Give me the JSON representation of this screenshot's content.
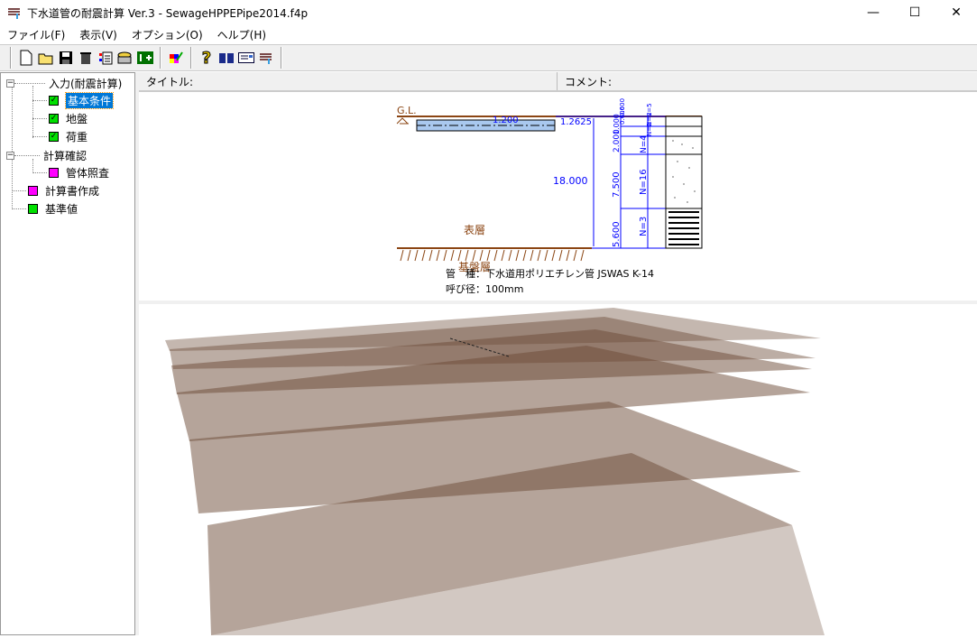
{
  "window": {
    "title": "下水道管の耐震計算 Ver.3 - SewageHPPEPipe2014.f4p",
    "minimize": "—",
    "maximize": "☐",
    "close": "✕"
  },
  "menu": [
    "ファイル(F)",
    "表示(V)",
    "オプション(O)",
    "ヘルプ(H)"
  ],
  "toolbar": {
    "icons": [
      "new-file-icon",
      "open-folder-icon",
      "save-icon",
      "trash-icon",
      "calc-icon",
      "db-icon",
      "exit-icon",
      "color-palette-icon",
      "help-icon",
      "book-icon",
      "id-card-icon",
      "app-icon"
    ]
  },
  "tree": {
    "root1": "入力(耐震計算)",
    "basic": "基本条件",
    "ground": "地盤",
    "load": "荷重",
    "root2": "計算確認",
    "pipe_check": "管体照査",
    "report": "計算書作成",
    "standard": "基準値"
  },
  "header": {
    "title_label": "タイトル:",
    "comment_label": "コメント:"
  },
  "diagram": {
    "gl": "G.L.",
    "cover": "1.200",
    "pipe_depth": "1.2625",
    "total": "18.000",
    "layer_thickness": [
      "0.600",
      "0.600",
      "1.000",
      "2.000",
      "7.500",
      "5.600"
    ],
    "n_values": [
      "N=5",
      "N=2",
      "N=2",
      "N=4",
      "N=16",
      "N=3"
    ],
    "surface_layer": "表層",
    "base_layer": "基盤層",
    "pipe_type": "管　種：下水道用ポリエチレン管 JSWAS K-14",
    "diameter": "呼び径：100mm"
  },
  "colors": {
    "accent": "#0078d7",
    "dim": "#0000ff",
    "earth": "#8b4513",
    "pipe": "#a9c8ef",
    "ok": "#00e000",
    "todo": "#ff00ff"
  }
}
